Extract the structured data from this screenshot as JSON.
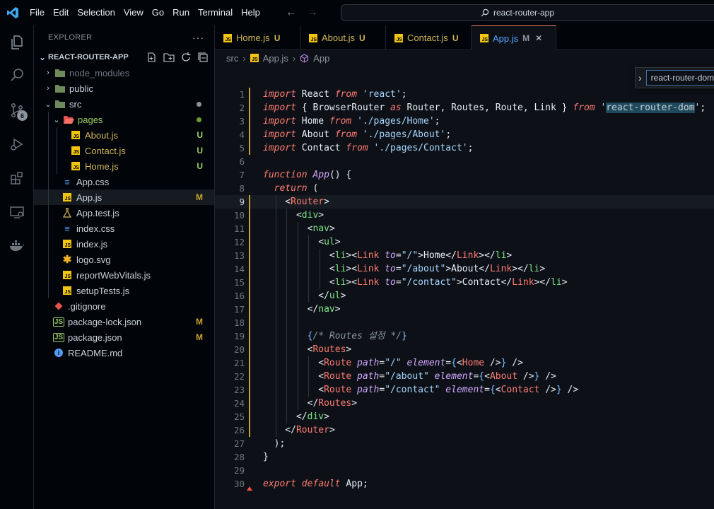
{
  "titlebar": {
    "menu": [
      "File",
      "Edit",
      "Selection",
      "View",
      "Go",
      "Run",
      "Terminal",
      "Help"
    ],
    "search": "react-router-app"
  },
  "activity": {
    "source_control_badge": "6",
    "icons": [
      "explorer-icon",
      "search-icon",
      "source-control-icon",
      "run-debug-icon",
      "extensions-icon",
      "remote-explorer-icon",
      "docker-icon"
    ]
  },
  "explorer": {
    "title": "EXPLORER",
    "more": "···",
    "project": "REACT-ROUTER-APP",
    "items": [
      {
        "label": "node_modules",
        "depth": 1,
        "type": "folder",
        "chev": "›",
        "faded": true
      },
      {
        "label": "public",
        "depth": 1,
        "type": "folder",
        "chev": "›"
      },
      {
        "label": "src",
        "depth": 1,
        "type": "folder",
        "chev": "⌄",
        "dot": "#8b949e"
      },
      {
        "label": "pages",
        "depth": 2,
        "type": "folder-open",
        "chev": "⌄",
        "dot": "#6f9a3a",
        "green": true
      },
      {
        "label": "About.js",
        "depth": 3,
        "type": "js",
        "status": "U",
        "yellow": true
      },
      {
        "label": "Contact.js",
        "depth": 3,
        "type": "js",
        "status": "U",
        "yellow": true
      },
      {
        "label": "Home.js",
        "depth": 3,
        "type": "js",
        "status": "U",
        "yellow": true
      },
      {
        "label": "App.css",
        "depth": 2,
        "type": "css"
      },
      {
        "label": "App.js",
        "depth": 2,
        "type": "js",
        "status": "M",
        "selected": true
      },
      {
        "label": "App.test.js",
        "depth": 2,
        "type": "test"
      },
      {
        "label": "index.css",
        "depth": 2,
        "type": "css"
      },
      {
        "label": "index.js",
        "depth": 2,
        "type": "js"
      },
      {
        "label": "logo.svg",
        "depth": 2,
        "type": "svg"
      },
      {
        "label": "reportWebVitals.js",
        "depth": 2,
        "type": "js"
      },
      {
        "label": "setupTests.js",
        "depth": 2,
        "type": "js"
      },
      {
        "label": ".gitignore",
        "depth": 1,
        "type": "git"
      },
      {
        "label": "package-lock.json",
        "depth": 1,
        "type": "json",
        "status": "M"
      },
      {
        "label": "package.json",
        "depth": 1,
        "type": "json",
        "status": "M"
      },
      {
        "label": "README.md",
        "depth": 1,
        "type": "info"
      }
    ]
  },
  "tabs": [
    {
      "name": "Home.js",
      "status": "U"
    },
    {
      "name": "About.js",
      "status": "U"
    },
    {
      "name": "Contact.js",
      "status": "U"
    },
    {
      "name": "App.js",
      "status": "M",
      "active": true,
      "close": "✕"
    }
  ],
  "breadcrumb": {
    "folder": "src",
    "file": "App.js",
    "symbol": "App"
  },
  "find": {
    "value": "react-router-dom"
  },
  "editor": {
    "current_line": 9,
    "lines": [
      [
        [
          "kw",
          "import"
        ],
        [
          "id",
          " React "
        ],
        [
          "kw",
          "from"
        ],
        [
          "str",
          " 'react'"
        ],
        [
          "punc",
          ";"
        ]
      ],
      [
        [
          "kw",
          "import"
        ],
        [
          "punc",
          " { "
        ],
        [
          "id",
          "BrowserRouter "
        ],
        [
          "kw",
          "as"
        ],
        [
          "id",
          " Router, Routes, Route, Link "
        ],
        [
          "punc",
          "} "
        ],
        [
          "kw",
          "from"
        ],
        [
          "str",
          " '"
        ],
        [
          "hl",
          "react-router-dom"
        ],
        [
          "str",
          "'"
        ],
        [
          "punc",
          ";"
        ]
      ],
      [
        [
          "kw",
          "import"
        ],
        [
          "id",
          " Home "
        ],
        [
          "kw",
          "from"
        ],
        [
          "str",
          " './pages/Home'"
        ],
        [
          "punc",
          ";"
        ]
      ],
      [
        [
          "kw",
          "import"
        ],
        [
          "id",
          " About "
        ],
        [
          "kw",
          "from"
        ],
        [
          "str",
          " './pages/About'"
        ],
        [
          "punc",
          ";"
        ]
      ],
      [
        [
          "kw",
          "import"
        ],
        [
          "id",
          " Contact "
        ],
        [
          "kw",
          "from"
        ],
        [
          "str",
          " './pages/Contact'"
        ],
        [
          "punc",
          ";"
        ]
      ],
      [],
      [
        [
          "kw2",
          "function"
        ],
        [
          "fn",
          " App"
        ],
        [
          "punc",
          "() {"
        ]
      ],
      [
        [
          "punc",
          "  "
        ],
        [
          "kw",
          "return"
        ],
        [
          "punc",
          " ("
        ]
      ],
      [
        [
          "punc",
          "    <"
        ],
        [
          "comp",
          "Router"
        ],
        [
          "punc",
          ">"
        ]
      ],
      [
        [
          "punc",
          "      <"
        ],
        [
          "tag",
          "div"
        ],
        [
          "punc",
          ">"
        ]
      ],
      [
        [
          "punc",
          "        <"
        ],
        [
          "tag",
          "nav"
        ],
        [
          "punc",
          ">"
        ]
      ],
      [
        [
          "punc",
          "          <"
        ],
        [
          "tag",
          "ul"
        ],
        [
          "punc",
          ">"
        ]
      ],
      [
        [
          "punc",
          "            <"
        ],
        [
          "tag",
          "li"
        ],
        [
          "punc",
          "><"
        ],
        [
          "comp",
          "Link"
        ],
        [
          "attr",
          " to"
        ],
        [
          "punc",
          "="
        ],
        [
          "str",
          "\"/\""
        ],
        [
          "punc",
          ">Home</"
        ],
        [
          "comp",
          "Link"
        ],
        [
          "punc",
          "></"
        ],
        [
          "tag",
          "li"
        ],
        [
          "punc",
          ">"
        ]
      ],
      [
        [
          "punc",
          "            <"
        ],
        [
          "tag",
          "li"
        ],
        [
          "punc",
          "><"
        ],
        [
          "comp",
          "Link"
        ],
        [
          "attr",
          " to"
        ],
        [
          "punc",
          "="
        ],
        [
          "str",
          "\"/about\""
        ],
        [
          "punc",
          ">About</"
        ],
        [
          "comp",
          "Link"
        ],
        [
          "punc",
          "></"
        ],
        [
          "tag",
          "li"
        ],
        [
          "punc",
          ">"
        ]
      ],
      [
        [
          "punc",
          "            <"
        ],
        [
          "tag",
          "li"
        ],
        [
          "punc",
          "><"
        ],
        [
          "comp",
          "Link"
        ],
        [
          "attr",
          " to"
        ],
        [
          "punc",
          "="
        ],
        [
          "str",
          "\"/contact\""
        ],
        [
          "punc",
          ">Contact</"
        ],
        [
          "comp",
          "Link"
        ],
        [
          "punc",
          "></"
        ],
        [
          "tag",
          "li"
        ],
        [
          "punc",
          ">"
        ]
      ],
      [
        [
          "punc",
          "          </"
        ],
        [
          "tag",
          "ul"
        ],
        [
          "punc",
          ">"
        ]
      ],
      [
        [
          "punc",
          "        </"
        ],
        [
          "tag",
          "nav"
        ],
        [
          "punc",
          ">"
        ]
      ],
      [],
      [
        [
          "punc",
          "        "
        ],
        [
          "brace",
          "{"
        ],
        [
          "cmt",
          "/* Routes 설정 */"
        ],
        [
          "brace",
          "}"
        ]
      ],
      [
        [
          "punc",
          "        <"
        ],
        [
          "comp",
          "Routes"
        ],
        [
          "punc",
          ">"
        ]
      ],
      [
        [
          "punc",
          "          <"
        ],
        [
          "comp",
          "Route"
        ],
        [
          "attr",
          " path"
        ],
        [
          "punc",
          "="
        ],
        [
          "str",
          "\"/\""
        ],
        [
          "attr",
          " element"
        ],
        [
          "punc",
          "="
        ],
        [
          "brace",
          "{"
        ],
        [
          "punc",
          "<"
        ],
        [
          "comp",
          "Home"
        ],
        [
          "punc",
          " />"
        ],
        [
          "brace",
          "}"
        ],
        [
          "punc",
          " />"
        ]
      ],
      [
        [
          "punc",
          "          <"
        ],
        [
          "comp",
          "Route"
        ],
        [
          "attr",
          " path"
        ],
        [
          "punc",
          "="
        ],
        [
          "str",
          "\"/about\""
        ],
        [
          "attr",
          " element"
        ],
        [
          "punc",
          "="
        ],
        [
          "brace",
          "{"
        ],
        [
          "punc",
          "<"
        ],
        [
          "comp",
          "About"
        ],
        [
          "punc",
          " />"
        ],
        [
          "brace",
          "}"
        ],
        [
          "punc",
          " />"
        ]
      ],
      [
        [
          "punc",
          "          <"
        ],
        [
          "comp",
          "Route"
        ],
        [
          "attr",
          " path"
        ],
        [
          "punc",
          "="
        ],
        [
          "str",
          "\"/contact\""
        ],
        [
          "attr",
          " element"
        ],
        [
          "punc",
          "="
        ],
        [
          "brace",
          "{"
        ],
        [
          "punc",
          "<"
        ],
        [
          "comp",
          "Contact"
        ],
        [
          "punc",
          " />"
        ],
        [
          "brace",
          "}"
        ],
        [
          "punc",
          " />"
        ]
      ],
      [
        [
          "punc",
          "        </"
        ],
        [
          "comp",
          "Routes"
        ],
        [
          "punc",
          ">"
        ]
      ],
      [
        [
          "punc",
          "      </"
        ],
        [
          "tag",
          "div"
        ],
        [
          "punc",
          ">"
        ]
      ],
      [
        [
          "punc",
          "    </"
        ],
        [
          "comp",
          "Router"
        ],
        [
          "punc",
          ">"
        ]
      ],
      [
        [
          "punc",
          "  );"
        ]
      ],
      [
        [
          "punc",
          "}"
        ]
      ],
      [],
      [
        [
          "kw",
          "export"
        ],
        [
          "kw",
          " default"
        ],
        [
          "id",
          " App"
        ],
        [
          "punc",
          ";"
        ]
      ]
    ]
  }
}
